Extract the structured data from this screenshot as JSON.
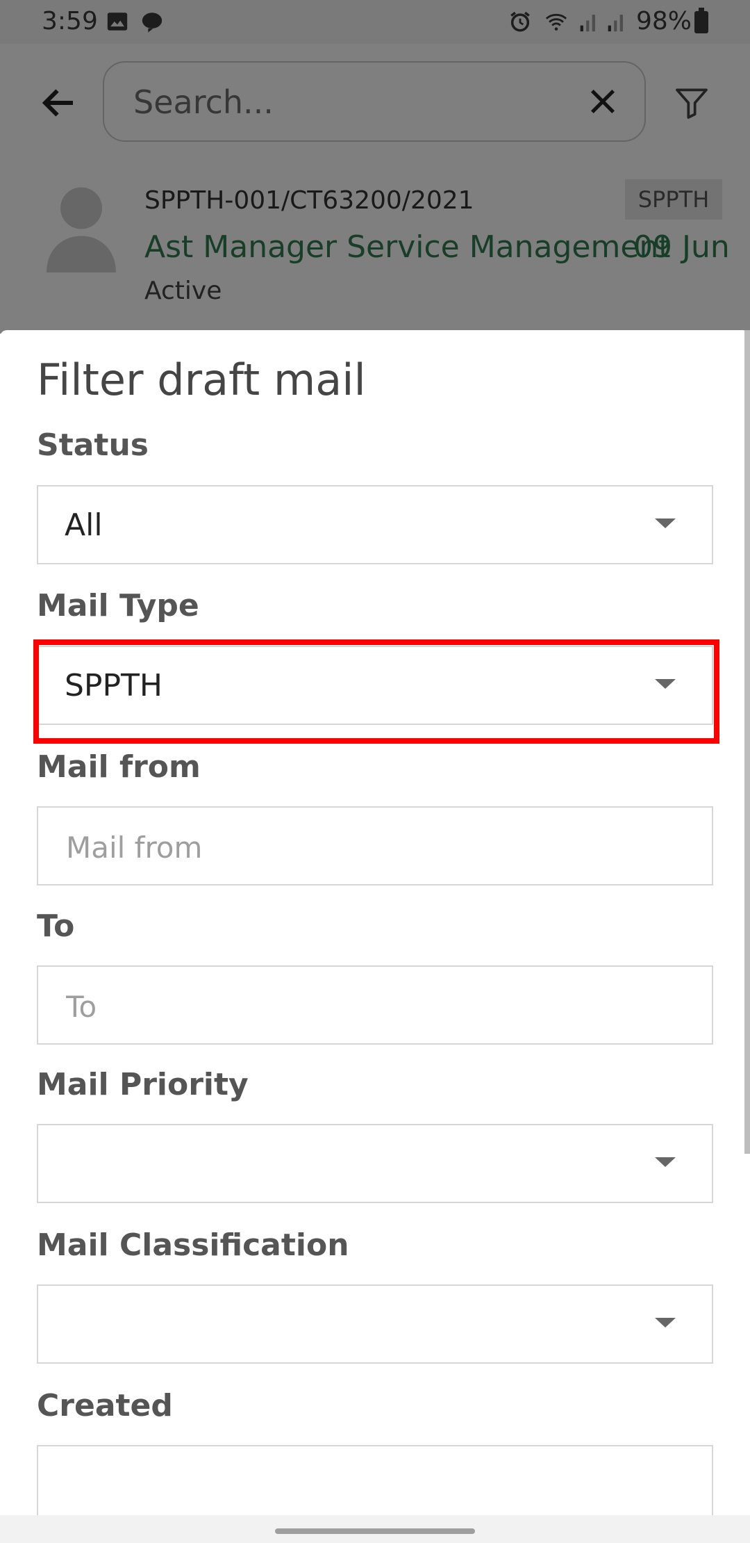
{
  "status_bar": {
    "time": "3:59",
    "battery_pct": "98%",
    "icons": [
      "gallery-icon",
      "line-icon",
      "alarm-icon",
      "wifi-icon",
      "signal-icon",
      "signal-icon",
      "battery-icon"
    ]
  },
  "toolbar": {
    "search_placeholder": "Search...",
    "search_value": ""
  },
  "list_item": {
    "id": "SPPTH-001/CT63200/2021",
    "badge": "SPPTH",
    "title": "Ast Manager Service Management",
    "date": "09 Jun",
    "status": "Active"
  },
  "filter_sheet": {
    "title": "Filter draft mail",
    "fields": [
      {
        "label": "Status",
        "value": "All",
        "type": "dropdown"
      },
      {
        "label": "Mail Type",
        "value": "SPPTH",
        "type": "dropdown"
      },
      {
        "label": "Mail from",
        "placeholder": "Mail from",
        "value": "",
        "type": "text"
      },
      {
        "label": "To",
        "placeholder": "To",
        "value": "",
        "type": "text"
      },
      {
        "label": "Mail Priority",
        "value": "",
        "type": "dropdown"
      },
      {
        "label": "Mail Classification",
        "value": "",
        "type": "dropdown"
      },
      {
        "label": "Created",
        "value": "",
        "type": "text"
      }
    ]
  },
  "colors": {
    "accent_green": "#2e7d4f",
    "highlight_red": "#ff0000",
    "scrim": "rgba(0,0,0,0.5)"
  }
}
